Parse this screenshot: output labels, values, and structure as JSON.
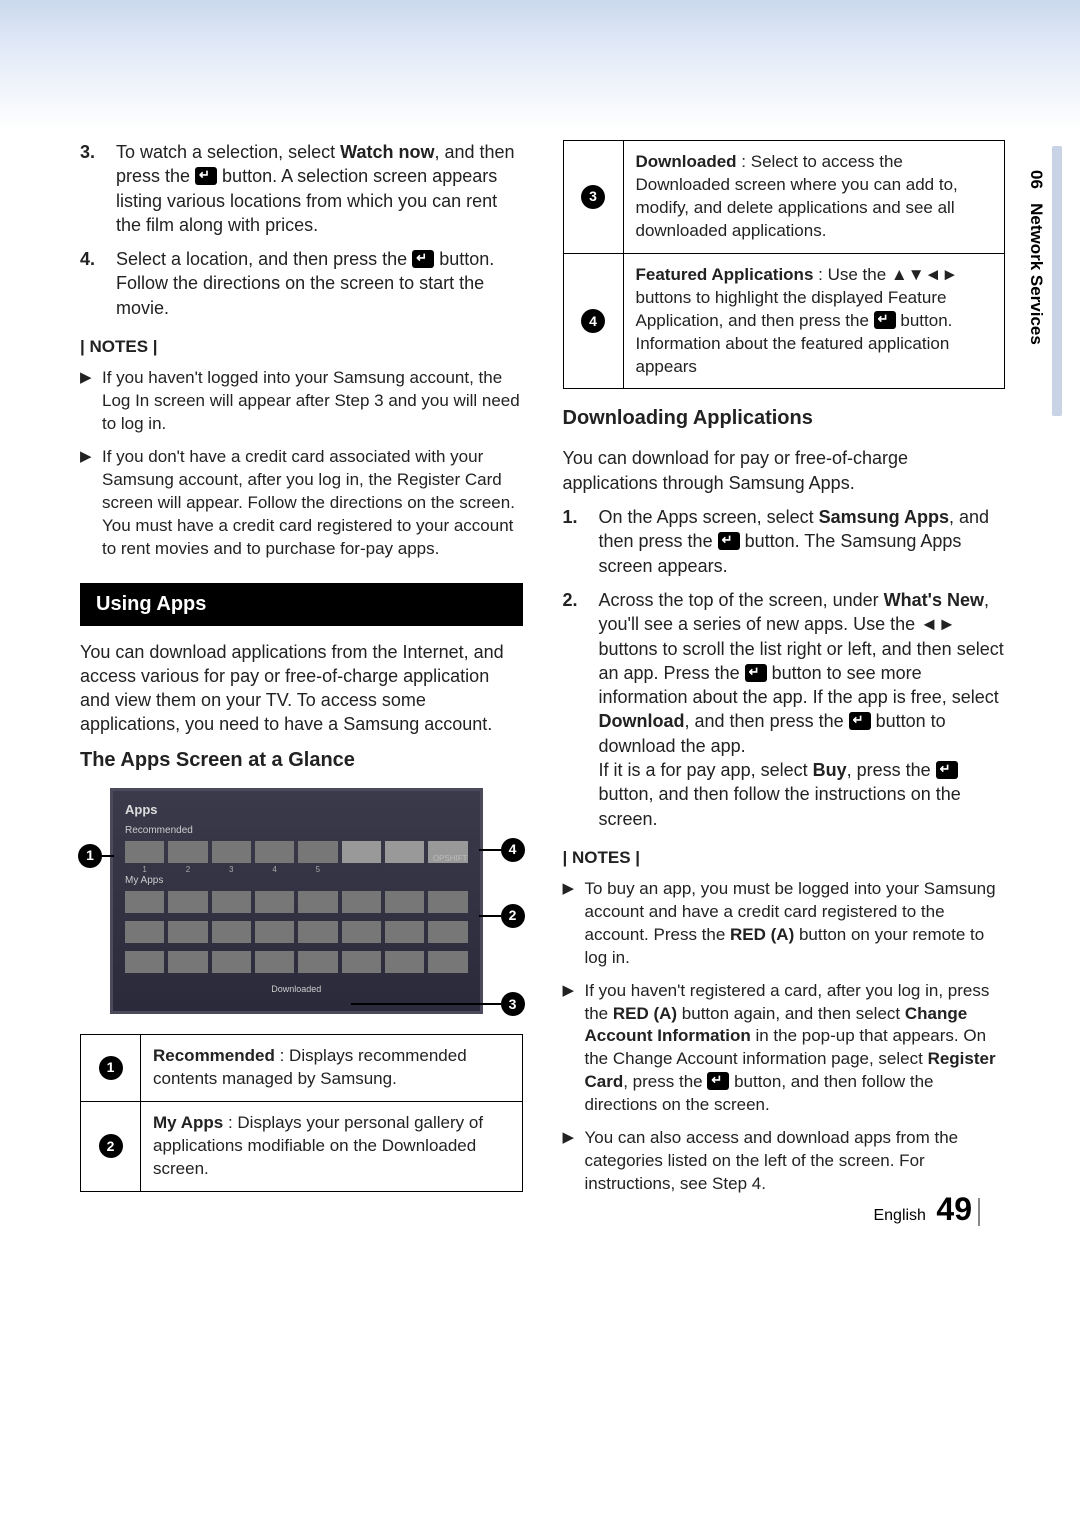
{
  "side_tab": {
    "section_num": "06",
    "section_name": "Network Services"
  },
  "left": {
    "ol_start": [
      {
        "num": "3.",
        "pre": "To watch a selection, select ",
        "bold1": "Watch now",
        "mid": ", and then press the ",
        "post": " button. A selection screen appears listing various locations from which you can rent the film along with prices."
      },
      {
        "num": "4.",
        "pre": "Select a location, and then press the ",
        "post": " button. Follow the directions on the screen to start the movie."
      }
    ],
    "notes_label": "| NOTES |",
    "notes": [
      "If you haven't logged into your Samsung account, the Log In screen will appear after Step 3 and you will need to log in.",
      "If you don't have a credit card associated with your Samsung account, after you log in, the Register Card screen will appear. Follow the directions on the screen. You must have a credit card registered to your account to rent movies and to purchase for-pay apps."
    ],
    "section_bar": "Using Apps",
    "section_intro": "You can download applications from the Internet, and access various for pay or free-of-charge application and view them on your TV. To access some applications, you need to have a Samsung account.",
    "subheading": "The Apps Screen at a Glance",
    "screen": {
      "title": "Apps",
      "recommended": "Recommended",
      "my_apps": "My Apps",
      "downloaded": "Downloaded",
      "opshift": "OPSHIFT"
    },
    "legend12": [
      {
        "n": "1",
        "bold": "Recommended",
        "rest": " : Displays recommended contents managed by Samsung."
      },
      {
        "n": "2",
        "bold": "My Apps",
        "rest": " : Displays your personal gallery of applications modifiable on the Downloaded screen."
      }
    ]
  },
  "right": {
    "legend34": [
      {
        "n": "3",
        "bold": "Downloaded",
        "rest": " : Select to access the Downloaded screen where you can add to, modify, and delete applications and see all downloaded applications."
      },
      {
        "n": "4",
        "bold": "Featured Applications",
        "pre": " : Use the ▲▼◄► buttons to highlight the displayed Feature Application, and then press the ",
        "post": " button. Information about the featured application appears"
      }
    ],
    "subheading": "Downloading Applications",
    "intro": "You can download for pay or free-of-charge applications through Samsung Apps.",
    "steps": [
      {
        "num": "1.",
        "pre": "On the Apps screen, select ",
        "b1": "Samsung Apps",
        "mid": ", and then press the ",
        "post": " button. The Samsung Apps screen appears."
      },
      {
        "num": "2.",
        "pre": "Across the top of the screen, under ",
        "b1": "What's New",
        "mid1": ", you'll see a series of new apps. Use the ◄► buttons to scroll the list right or left, and then select an app. Press the ",
        "mid2": " button to see more information about the app. If the app is free, select ",
        "b2": "Download",
        "mid3": ", and then press the ",
        "mid4": " button to download the app.",
        "br": "If it is a for pay app, select ",
        "b3": "Buy",
        "mid5": ", press the ",
        "post": " button, and then follow the instructions on the screen."
      }
    ],
    "notes_label": "| NOTES |",
    "notes": [
      {
        "plain": "To buy an app, you must be logged into your Samsung account and have a credit card registered to the account. Press the ",
        "b1": "RED (A)",
        "plain2": " button on your remote to log in."
      },
      {
        "plain": "If you haven't registered a card, after you log in, press the ",
        "b1": "RED (A)",
        "mid1": " button again, and then select ",
        "b2": "Change Account Information",
        "mid2": " in the pop-up that appears. On the Change Account information page, select ",
        "b3": "Register Card",
        "mid3": ", press the ",
        "post": " button, and then follow the directions on the screen."
      },
      {
        "plain": "You can also access and download apps from the categories listed on the left of the screen. For instructions, see Step 4."
      }
    ]
  },
  "footer": {
    "lang": "English",
    "page": "49"
  }
}
